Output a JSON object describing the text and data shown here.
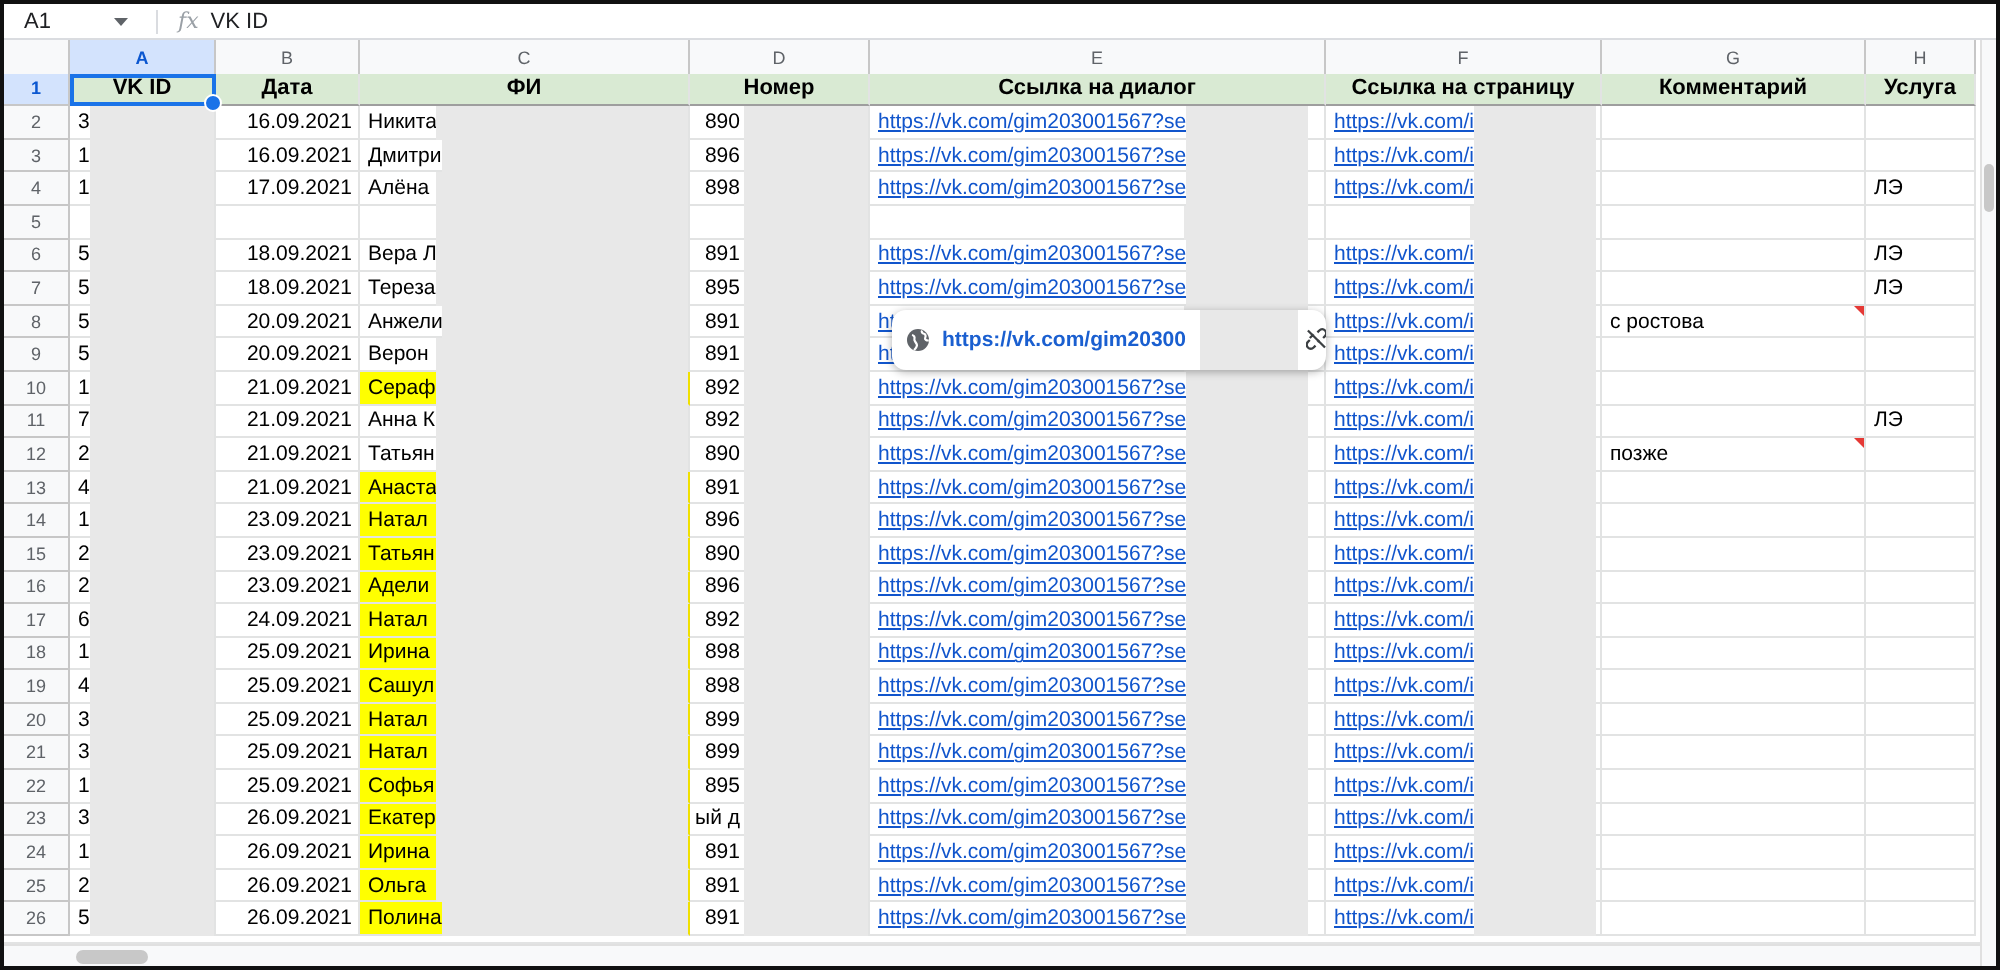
{
  "formula_bar": {
    "cell_ref": "A1",
    "fx": "fx",
    "formula": "VK ID"
  },
  "columns": [
    {
      "letter": "A",
      "selected": true,
      "kind": "text",
      "redacted": true
    },
    {
      "letter": "B",
      "selected": false,
      "kind": "number",
      "redacted": false
    },
    {
      "letter": "C",
      "selected": false,
      "kind": "text",
      "redacted": true
    },
    {
      "letter": "D",
      "selected": false,
      "kind": "number",
      "redacted": true
    },
    {
      "letter": "E",
      "selected": false,
      "kind": "link",
      "redacted": true
    },
    {
      "letter": "F",
      "selected": false,
      "kind": "link",
      "redacted": true
    },
    {
      "letter": "G",
      "selected": false,
      "kind": "text",
      "redacted": false
    },
    {
      "letter": "H",
      "selected": false,
      "kind": "text",
      "redacted": false
    }
  ],
  "rows": [
    {
      "number": "1",
      "selected": true,
      "kind": "header",
      "cells": {
        "A": "VK ID",
        "B": "Дата",
        "C": "ФИ",
        "D": "Номер",
        "E": "Ссылка на диалог",
        "F": "Ссылка на страницу",
        "G": "Комментарий",
        "H": "Услуга"
      }
    },
    {
      "number": "2",
      "selected": false,
      "kind": "data",
      "name_highlighted": false,
      "has_comment": false,
      "cells": {
        "A": "3",
        "B": "16.09.2021",
        "C": "Никита",
        "D": "890",
        "E": "https://vk.com/gim203001567?se",
        "F": "https://vk.com/i"
      }
    },
    {
      "number": "3",
      "selected": false,
      "kind": "data",
      "name_highlighted": false,
      "has_comment": false,
      "cells": {
        "A": "1",
        "B": "16.09.2021",
        "C": "Дмитри",
        "D": "896",
        "E": "https://vk.com/gim203001567?se",
        "F": "https://vk.com/i"
      }
    },
    {
      "number": "4",
      "selected": false,
      "kind": "data",
      "name_highlighted": false,
      "has_comment": false,
      "cells": {
        "A": "1",
        "B": "17.09.2021",
        "C": "Алёна",
        "D": "898",
        "E": "https://vk.com/gim203001567?se",
        "F": "https://vk.com/i",
        "H": "ЛЭ"
      }
    },
    {
      "number": "5",
      "selected": false,
      "kind": "data",
      "name_highlighted": false,
      "has_comment": false
    },
    {
      "number": "6",
      "selected": false,
      "kind": "data",
      "name_highlighted": false,
      "has_comment": false,
      "cells": {
        "A": "5",
        "B": "18.09.2021",
        "C": "Вера Л",
        "D": "891",
        "E": "https://vk.com/gim203001567?se",
        "F": "https://vk.com/i",
        "H": "ЛЭ"
      }
    },
    {
      "number": "7",
      "selected": false,
      "kind": "data",
      "name_highlighted": false,
      "has_comment": false,
      "cells": {
        "A": "5",
        "B": "18.09.2021",
        "C": "Тереза",
        "D": "895",
        "E": "https://vk.com/gim203001567?se",
        "F": "https://vk.com/i",
        "H": "ЛЭ"
      }
    },
    {
      "number": "8",
      "selected": false,
      "kind": "data",
      "name_highlighted": false,
      "has_comment": true,
      "cells": {
        "A": "5",
        "B": "20.09.2021",
        "C": "Анжели",
        "D": "891",
        "E": "ht",
        "F": "https://vk.com/i",
        "G": "с ростова"
      },
      "tooltip": {
        "url": "https://vk.com/gim20300"
      }
    },
    {
      "number": "9",
      "selected": false,
      "kind": "data",
      "name_highlighted": false,
      "has_comment": false,
      "cells": {
        "A": "5",
        "B": "20.09.2021",
        "C": "Верон",
        "D": "891",
        "E": "ht",
        "F": "https://vk.com/i"
      }
    },
    {
      "number": "10",
      "selected": false,
      "kind": "data",
      "name_highlighted": true,
      "has_comment": false,
      "cells": {
        "A": "1",
        "B": "21.09.2021",
        "C": "Сераф",
        "D": "892",
        "E": "https://vk.com/gim203001567?se",
        "F": "https://vk.com/i"
      }
    },
    {
      "number": "11",
      "selected": false,
      "kind": "data",
      "name_highlighted": false,
      "has_comment": false,
      "cells": {
        "A": "7",
        "B": "21.09.2021",
        "C": "Анна К",
        "D": "892",
        "E": "https://vk.com/gim203001567?se",
        "F": "https://vk.com/i",
        "H": "ЛЭ"
      }
    },
    {
      "number": "12",
      "selected": false,
      "kind": "data",
      "name_highlighted": false,
      "has_comment": true,
      "cells": {
        "A": "2",
        "B": "21.09.2021",
        "C": "Татьян",
        "D": "890",
        "E": "https://vk.com/gim203001567?se",
        "F": "https://vk.com/i",
        "G": "позже"
      }
    },
    {
      "number": "13",
      "selected": false,
      "kind": "data",
      "name_highlighted": true,
      "has_comment": false,
      "cells": {
        "A": "4",
        "B": "21.09.2021",
        "C": "Анаста",
        "D": "891",
        "E": "https://vk.com/gim203001567?se",
        "F": "https://vk.com/i"
      }
    },
    {
      "number": "14",
      "selected": false,
      "kind": "data",
      "name_highlighted": true,
      "has_comment": false,
      "cells": {
        "A": "1",
        "B": "23.09.2021",
        "C": "Натал",
        "D": "896",
        "E": "https://vk.com/gim203001567?se",
        "F": "https://vk.com/i"
      }
    },
    {
      "number": "15",
      "selected": false,
      "kind": "data",
      "name_highlighted": true,
      "has_comment": false,
      "cells": {
        "A": "2",
        "B": "23.09.2021",
        "C": "Татьян",
        "D": "890",
        "E": "https://vk.com/gim203001567?se",
        "F": "https://vk.com/i"
      }
    },
    {
      "number": "16",
      "selected": false,
      "kind": "data",
      "name_highlighted": true,
      "has_comment": false,
      "cells": {
        "A": "2",
        "B": "23.09.2021",
        "C": "Адели",
        "D": "896",
        "E": "https://vk.com/gim203001567?se",
        "F": "https://vk.com/i"
      }
    },
    {
      "number": "17",
      "selected": false,
      "kind": "data",
      "name_highlighted": true,
      "has_comment": false,
      "cells": {
        "A": "6",
        "B": "24.09.2021",
        "C": "Натал",
        "D": "892",
        "E": "https://vk.com/gim203001567?se",
        "F": "https://vk.com/i"
      }
    },
    {
      "number": "18",
      "selected": false,
      "kind": "data",
      "name_highlighted": true,
      "has_comment": false,
      "cells": {
        "A": "1",
        "B": "25.09.2021",
        "C": "Ирина",
        "D": "898",
        "E": "https://vk.com/gim203001567?se",
        "F": "https://vk.com/i"
      }
    },
    {
      "number": "19",
      "selected": false,
      "kind": "data",
      "name_highlighted": true,
      "has_comment": false,
      "cells": {
        "A": "4",
        "B": "25.09.2021",
        "C": "Сашул",
        "D": "898",
        "E": "https://vk.com/gim203001567?se",
        "F": "https://vk.com/i"
      }
    },
    {
      "number": "20",
      "selected": false,
      "kind": "data",
      "name_highlighted": true,
      "has_comment": false,
      "cells": {
        "A": "3",
        "B": "25.09.2021",
        "C": "Натал",
        "D": "899",
        "E": "https://vk.com/gim203001567?se",
        "F": "https://vk.com/i"
      }
    },
    {
      "number": "21",
      "selected": false,
      "kind": "data",
      "name_highlighted": true,
      "has_comment": false,
      "cells": {
        "A": "3",
        "B": "25.09.2021",
        "C": "Натал",
        "D": "899",
        "E": "https://vk.com/gim203001567?se",
        "F": "https://vk.com/i"
      }
    },
    {
      "number": "22",
      "selected": false,
      "kind": "data",
      "name_highlighted": true,
      "has_comment": false,
      "cells": {
        "A": "1",
        "B": "25.09.2021",
        "C": "Софья",
        "D": "895",
        "E": "https://vk.com/gim203001567?se",
        "F": "https://vk.com/i"
      }
    },
    {
      "number": "23",
      "selected": false,
      "kind": "data",
      "name_highlighted": true,
      "has_comment": false,
      "cells": {
        "A": "3",
        "B": "26.09.2021",
        "C": "Екатер",
        "D": "ый д",
        "E": "https://vk.com/gim203001567?se",
        "F": "https://vk.com/i"
      }
    },
    {
      "number": "24",
      "selected": false,
      "kind": "data",
      "name_highlighted": true,
      "has_comment": false,
      "cells": {
        "A": "1",
        "B": "26.09.2021",
        "C": "Ирина",
        "D": "891",
        "E": "https://vk.com/gim203001567?se",
        "F": "https://vk.com/i"
      }
    },
    {
      "number": "25",
      "selected": false,
      "kind": "data",
      "name_highlighted": true,
      "has_comment": false,
      "cells": {
        "A": "2",
        "B": "26.09.2021",
        "C": "Ольга",
        "D": "891",
        "E": "https://vk.com/gim203001567?se",
        "F": "https://vk.com/i"
      }
    },
    {
      "number": "26",
      "selected": false,
      "kind": "data",
      "name_highlighted": true,
      "has_comment": false,
      "cells": {
        "A": "5",
        "B": "26.09.2021",
        "C": "Полина",
        "D": "891",
        "E": "https://vk.com/gim203001567?se",
        "F": "https://vk.com/i"
      }
    }
  ]
}
